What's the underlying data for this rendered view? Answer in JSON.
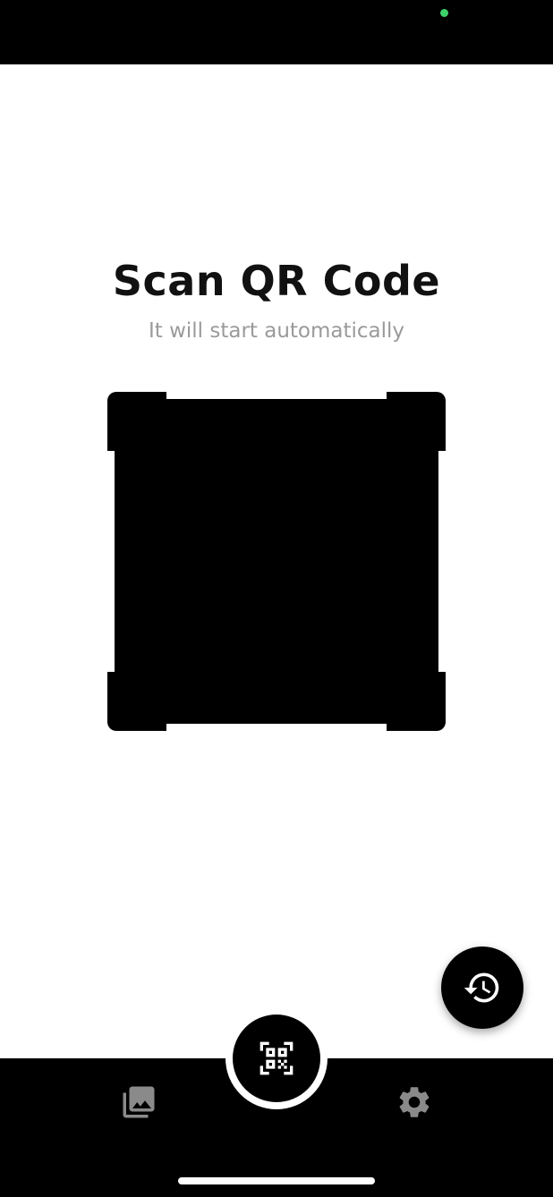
{
  "header": {
    "title": "Scan QR Code",
    "subtitle": "It will start automatically"
  },
  "icons": {
    "history": "history-icon",
    "scan": "qr-code-scanner-icon",
    "gallery": "photo-library-icon",
    "settings": "gear-icon"
  },
  "colors": {
    "background": "#ffffff",
    "bars": "#000000",
    "subtitle": "#9a9a9a",
    "camera_dot": "#3fd16a",
    "nav_icon": "#8a8a8a"
  }
}
